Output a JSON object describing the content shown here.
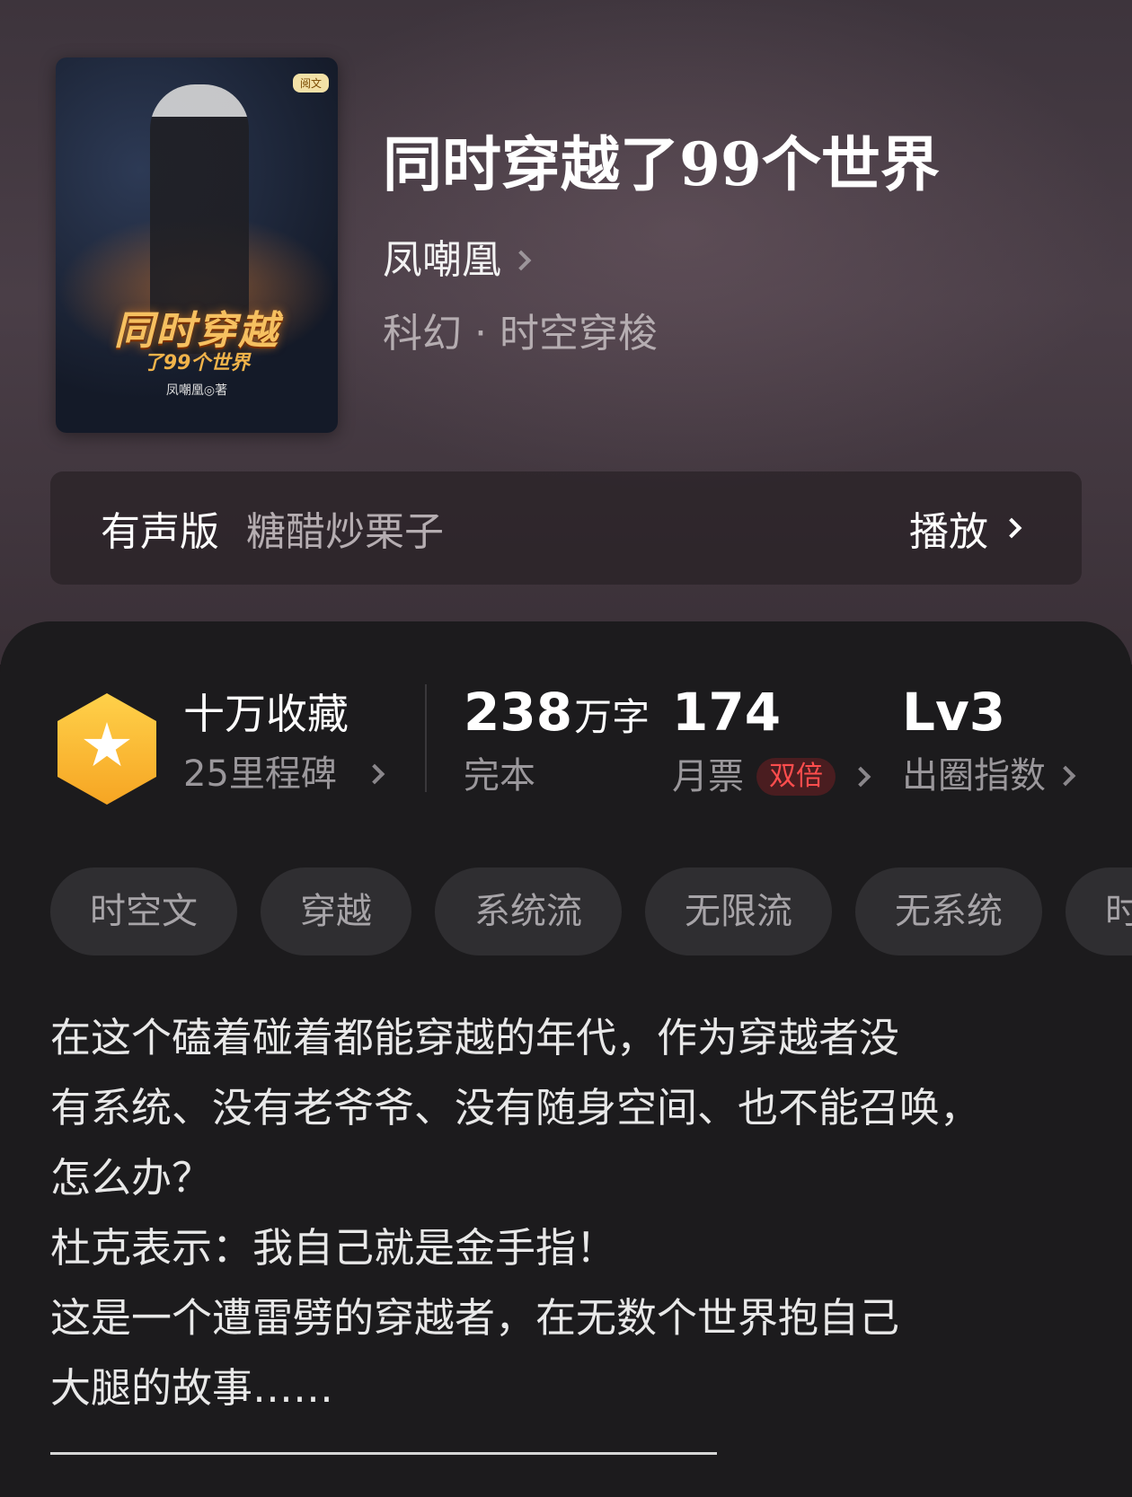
{
  "book": {
    "cover": {
      "title_art": "同时穿越",
      "subtitle_art": "了99个世界",
      "author_art": "凤嘲凰◎著",
      "publisher_badge": "阅文"
    },
    "title": "同时穿越了99个世界",
    "author": "凤嘲凰",
    "genre": "科幻 · 时空穿梭"
  },
  "audio": {
    "label": "有声版",
    "narrator": "糖醋炒栗子",
    "play_label": "播放"
  },
  "stats": {
    "favorites_title": "十万收藏",
    "milestones": "25里程碑",
    "word_count": "238",
    "word_unit": "万字",
    "status": "完本",
    "monthly_votes": "174",
    "monthly_votes_label": "月票",
    "double_badge": "双倍",
    "influence": "Lv3",
    "influence_label": "出圈指数"
  },
  "tags": [
    "时空文",
    "穿越",
    "系统流",
    "无限流",
    "无系统",
    "时"
  ],
  "description": "在这个磕着碰着都能穿越的年代，作为穿越者没\n有系统、没有老爷爷、没有随身空间、也不能召唤，\n怎么办？\n杜克表示：我自己就是金手指！\n这是一个遭雷劈的穿越者，在无数个世界抱自己\n大腿的故事……",
  "colors": {
    "accent_gold": "#f6a523",
    "badge_red": "#ff4d4d",
    "panel_bg": "#1c1b1d"
  }
}
